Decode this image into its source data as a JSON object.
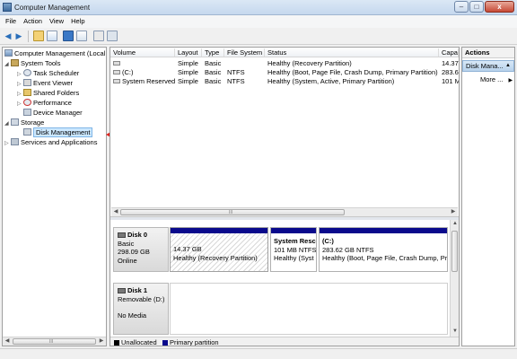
{
  "window": {
    "title": "Computer Management"
  },
  "menu": [
    "File",
    "Action",
    "View",
    "Help"
  ],
  "tree": {
    "root": "Computer Management (Local",
    "system_tools": "System Tools",
    "task_scheduler": "Task Scheduler",
    "event_viewer": "Event Viewer",
    "shared_folders": "Shared Folders",
    "performance": "Performance",
    "device_manager": "Device Manager",
    "storage": "Storage",
    "disk_management": "Disk Management",
    "services": "Services and Applications",
    "scroll_grip": "III"
  },
  "volume_list": {
    "columns": [
      "Volume",
      "Layout",
      "Type",
      "File System",
      "Status",
      "Capac"
    ],
    "rows": [
      {
        "volume": "",
        "layout": "Simple",
        "type": "Basic",
        "fs": "",
        "status": "Healthy (Recovery Partition)",
        "capacity": "14.37"
      },
      {
        "volume": "(C:)",
        "layout": "Simple",
        "type": "Basic",
        "fs": "NTFS",
        "status": "Healthy (Boot, Page File, Crash Dump, Primary Partition)",
        "capacity": "283.6."
      },
      {
        "volume": "System Reserved",
        "layout": "Simple",
        "type": "Basic",
        "fs": "NTFS",
        "status": "Healthy (System, Active, Primary Partition)",
        "capacity": "101 M"
      }
    ],
    "scroll_grip": "III"
  },
  "disks": [
    {
      "name": "Disk 0",
      "kind": "Basic",
      "size": "298.09 GB",
      "state": "Online",
      "partitions": [
        {
          "name": "",
          "size": "14.37 GB",
          "status": "Healthy (Recovery Partition)"
        },
        {
          "name": "System Resc",
          "size": "101 MB NTFS",
          "status": "Healthy (Syst"
        },
        {
          "name": "(C:)",
          "size": "283.62 GB NTFS",
          "status": "Healthy (Boot, Page File, Crash Dump, Pr"
        }
      ]
    },
    {
      "name": "Disk 1",
      "kind": "Removable (D:)",
      "state": "No Media"
    }
  ],
  "legend": [
    {
      "label": "Unallocated",
      "color": "#000000"
    },
    {
      "label": "Primary partition",
      "color": "#0a0a8c"
    }
  ],
  "actions": {
    "header": "Actions",
    "section": "Disk Mana...",
    "more": "More ..."
  },
  "annotation": {
    "arrow_color": "#e0201b"
  }
}
